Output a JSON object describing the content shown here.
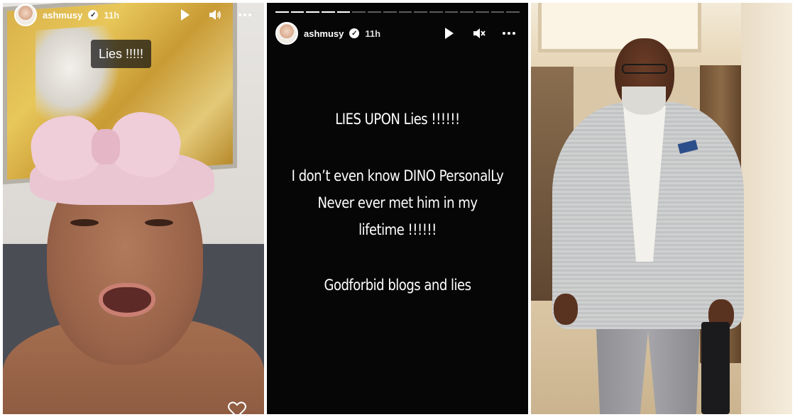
{
  "left_story": {
    "username": "ashmusy",
    "time": "11h",
    "sticker": "Lies !!!!!",
    "icons": {
      "verified": "verified-badge-icon",
      "play": "play-icon",
      "sound": "speaker-on-icon",
      "more": "more-dots-icon",
      "like": "heart-icon"
    }
  },
  "mid_story": {
    "username": "ashmusy",
    "time": "11h",
    "lines": [
      "LIES UPON Lies !!!!!!",
      "I don’t even know DINO PersonalLy",
      "Never ever met him in my",
      "lifetime !!!!!!",
      "Godforbid blogs and lies"
    ],
    "icons": {
      "verified": "verified-badge-icon",
      "play": "play-icon",
      "sound": "speaker-muted-icon",
      "more": "more-dots-icon"
    },
    "progress_segments_viewed": 5,
    "progress_segments_total": 16
  },
  "right_photo": {
    "description_icon": "photo-man-in-grey-suit"
  },
  "colors": {
    "story_text": "#ffffff",
    "mid_background": "#060606",
    "pocket_square": "#2c4e8a"
  }
}
